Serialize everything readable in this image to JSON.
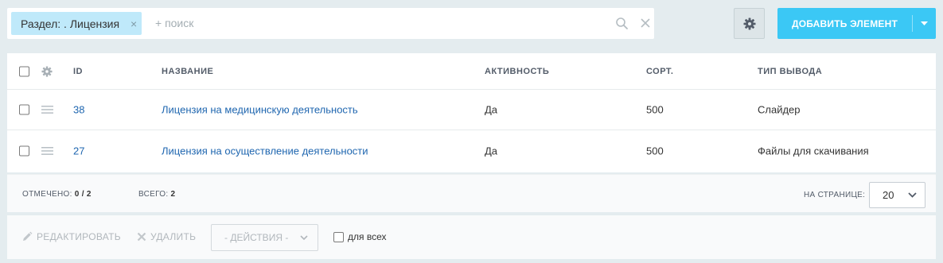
{
  "filter": {
    "tag_label": "Раздел: . Лицензия",
    "tag_close": "×",
    "search_placeholder": "+ поиск"
  },
  "toolbar": {
    "add_label": "ДОБАВИТЬ ЭЛЕМЕНТ"
  },
  "grid": {
    "columns": [
      "ID",
      "НАЗВАНИЕ",
      "АКТИВНОСТЬ",
      "СОРТ.",
      "ТИП ВЫВОДА"
    ],
    "rows": [
      {
        "id": "38",
        "name": "Лицензия на медицинскую деятельность",
        "active": "Да",
        "sort": "500",
        "type": "Слайдер"
      },
      {
        "id": "27",
        "name": "Лицензия на осуществление деятельности",
        "active": "Да",
        "sort": "500",
        "type": "Файлы для скачивания"
      }
    ]
  },
  "summary": {
    "checked_label": "ОТМЕЧЕНО:",
    "checked_value": "0 / 2",
    "total_label": "ВСЕГО:",
    "total_value": "2",
    "per_page_label": "НА СТРАНИЦЕ:",
    "per_page_value": "20"
  },
  "actions": {
    "edit_label": "РЕДАКТИРОВАТЬ",
    "delete_label": "УДАЛИТЬ",
    "actions_select": "- ДЕЙСТВИЯ -",
    "for_all_label": "для всех"
  },
  "colors": {
    "accent": "#3bc8f5",
    "tag_bg": "#bfe9fa",
    "link": "#2067b0",
    "page_bg": "#e4ecef"
  },
  "icons": [
    "search-icon",
    "clear-icon",
    "gear-icon",
    "chevron-down-icon",
    "drag-handle-icon",
    "pencil-icon",
    "close-icon"
  ]
}
